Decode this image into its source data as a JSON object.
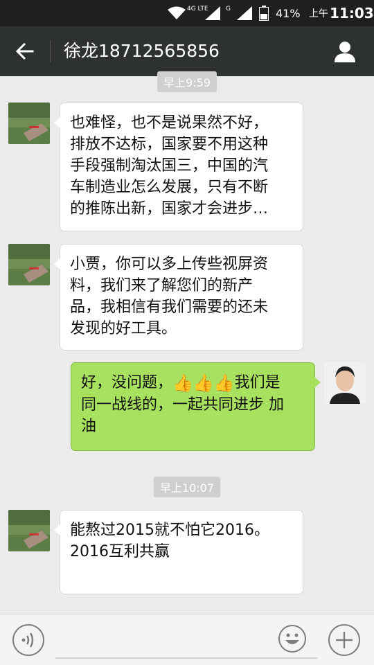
{
  "status_bar": {
    "network_label": "4G LTE",
    "g_label": "G",
    "battery_percent": "41%",
    "time_prefix": "上午",
    "time": "11:03"
  },
  "header": {
    "title": "徐龙18712565856"
  },
  "messages": [
    {
      "type": "timestamp",
      "text": "早上9:59"
    },
    {
      "type": "incoming",
      "text_lines": [
        "也难怪，也不是说果然不好，",
        "排放不达标，国家要不用这种",
        "手段强制淘汰国三，中国的汽",
        "车制造业怎么发展，只有不断",
        "的推陈出新，国家才会进步…"
      ]
    },
    {
      "type": "incoming",
      "text_lines": [
        "小贾，你可以多上传些视屏资",
        "料，我们来了解您们的新产",
        "品，我相信有我们需要的还未",
        "发现的好工具。"
      ]
    },
    {
      "type": "outgoing",
      "line1_pre": "好，没问题，",
      "thumbs": "👍👍👍",
      "line1_post": "我们是",
      "line2": "同一战线的，一起共同进步  加",
      "line3": "油"
    },
    {
      "type": "timestamp",
      "text": "早上10:07"
    },
    {
      "type": "incoming",
      "text_lines": [
        "能熬过2015就不怕它2016。",
        "2016互利共赢"
      ]
    }
  ],
  "colors": {
    "outgoing_bubble": "#a8e05f",
    "incoming_bubble": "#ffffff",
    "chat_background": "#ebebeb",
    "header_background": "#2e3132"
  },
  "icons": {
    "back": "back-arrow-icon",
    "profile": "person-icon",
    "voice": "voice-icon",
    "emoji": "emoji-icon",
    "plus": "plus-icon"
  }
}
